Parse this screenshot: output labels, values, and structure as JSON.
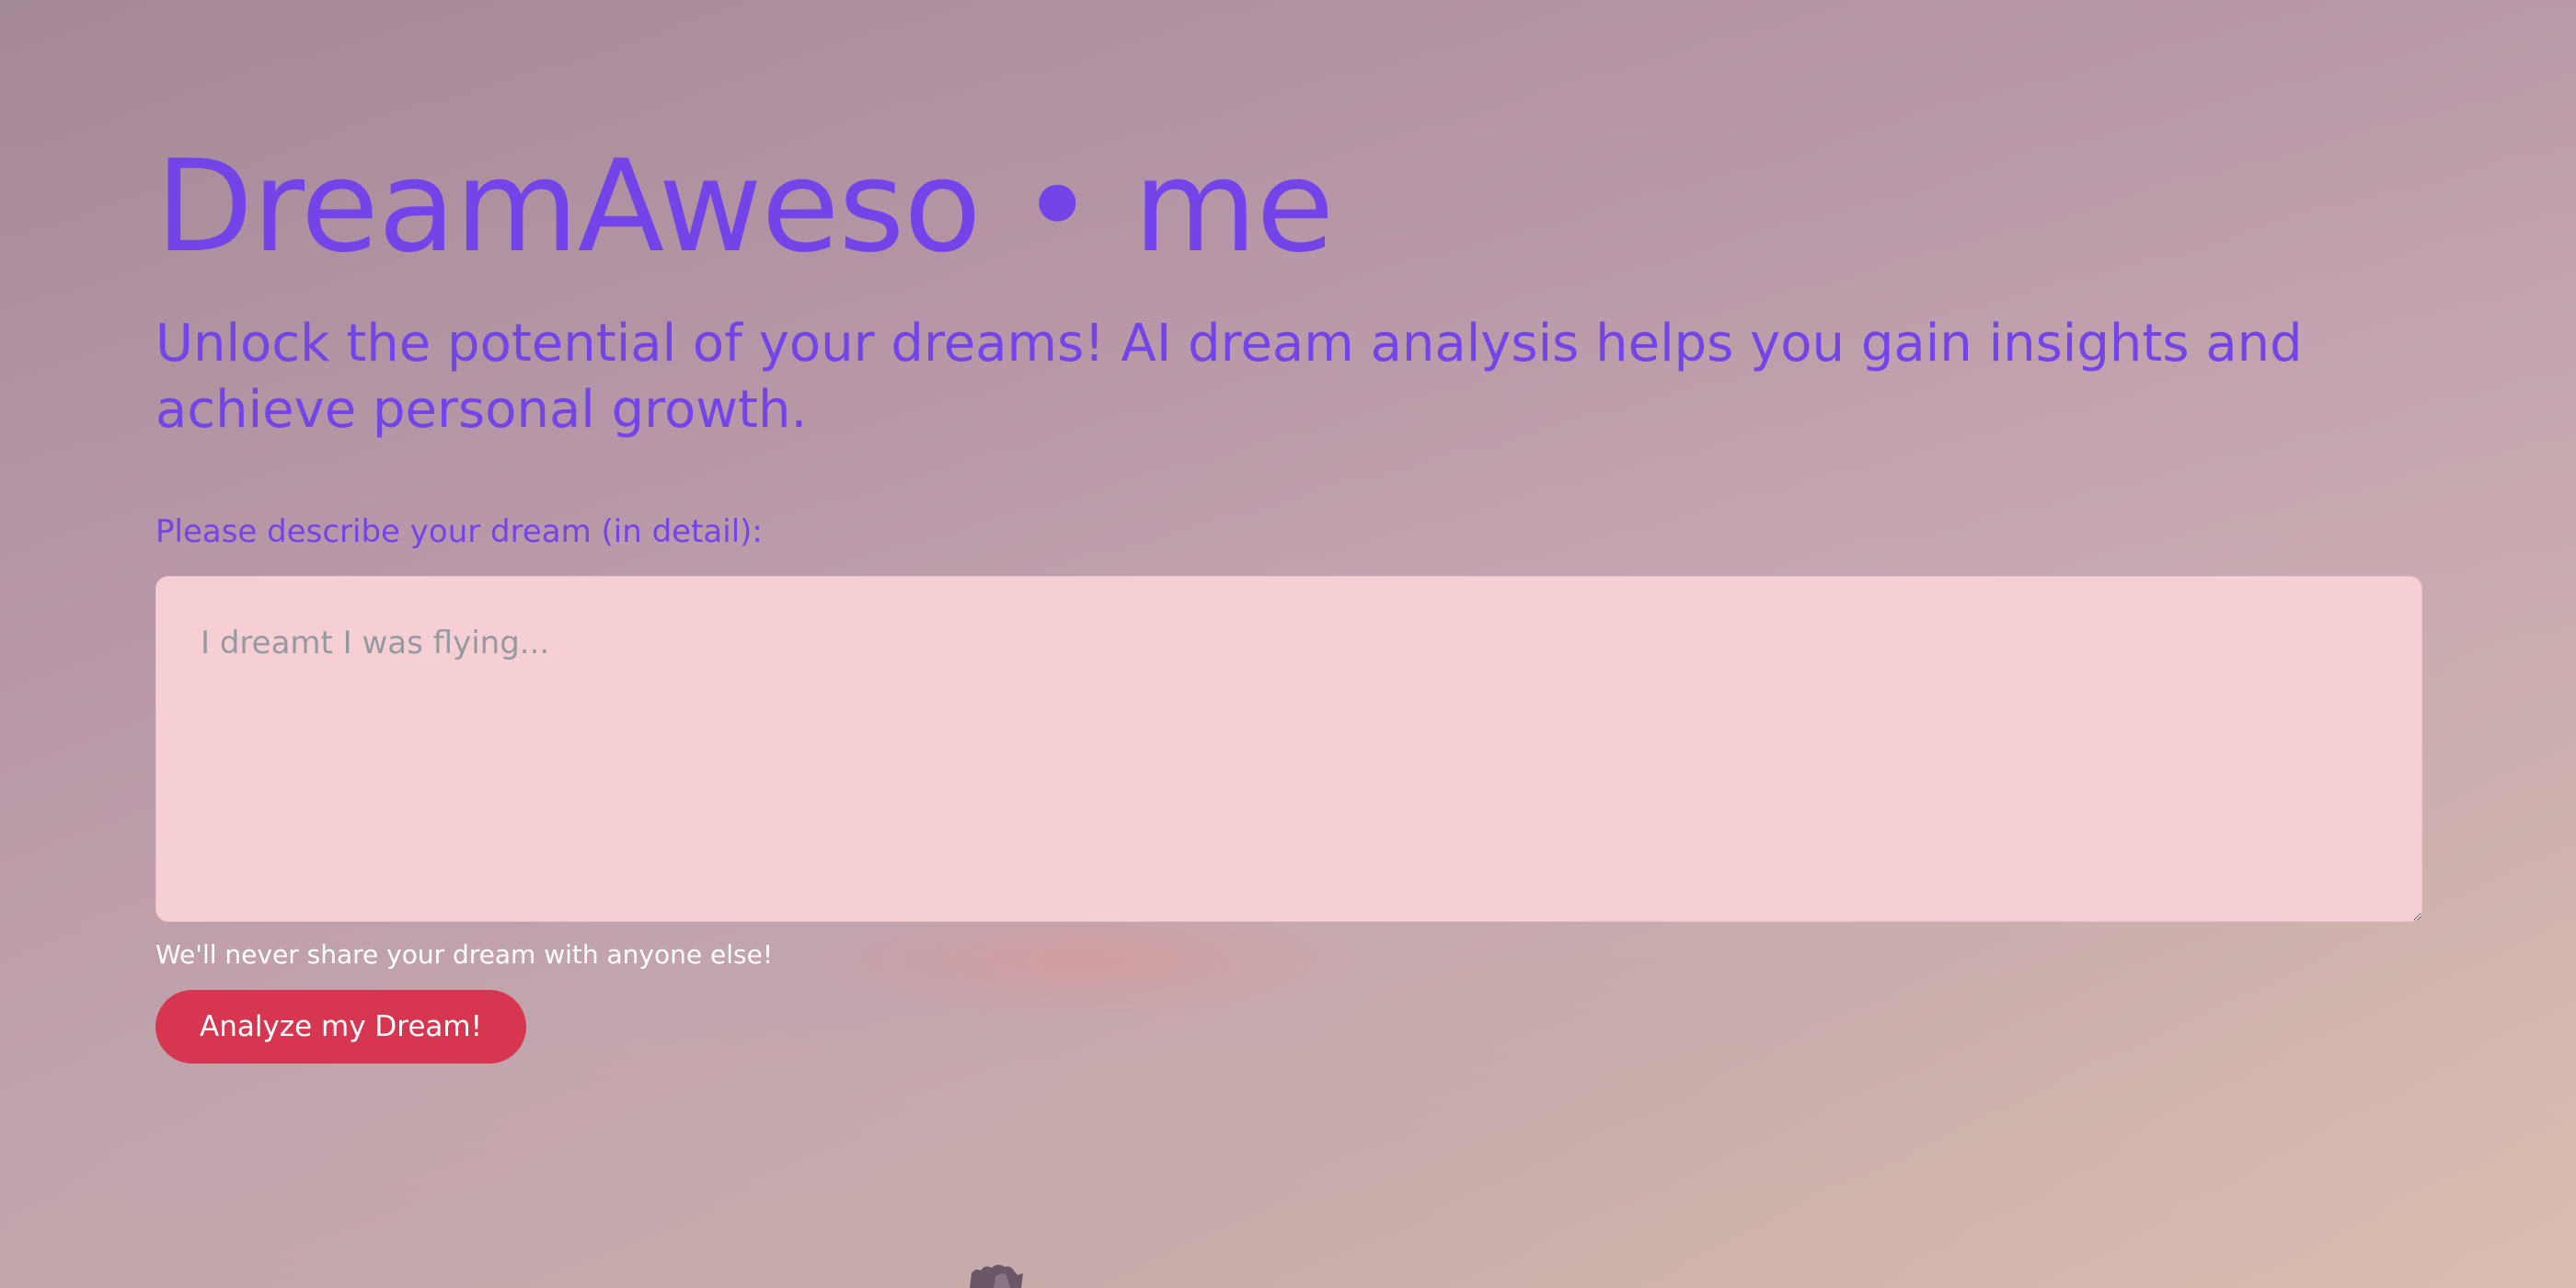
{
  "header": {
    "site_title": "DreamAweso • me",
    "tagline": "Unlock the potential of your dreams! AI dream analysis helps you gain insights and achieve personal growth."
  },
  "form": {
    "dream_label": "Please describe your dream (in detail):",
    "dream_placeholder": "I dreamt I was flying...",
    "dream_value": "",
    "privacy_note": "We'll never share your dream with anyone else!",
    "submit_label": "Analyze my Dream!"
  },
  "colors": {
    "accent": "#7444e8",
    "button": "#d6364f",
    "textarea_bg": "#f6cfd5",
    "help_text": "#ffffff"
  }
}
